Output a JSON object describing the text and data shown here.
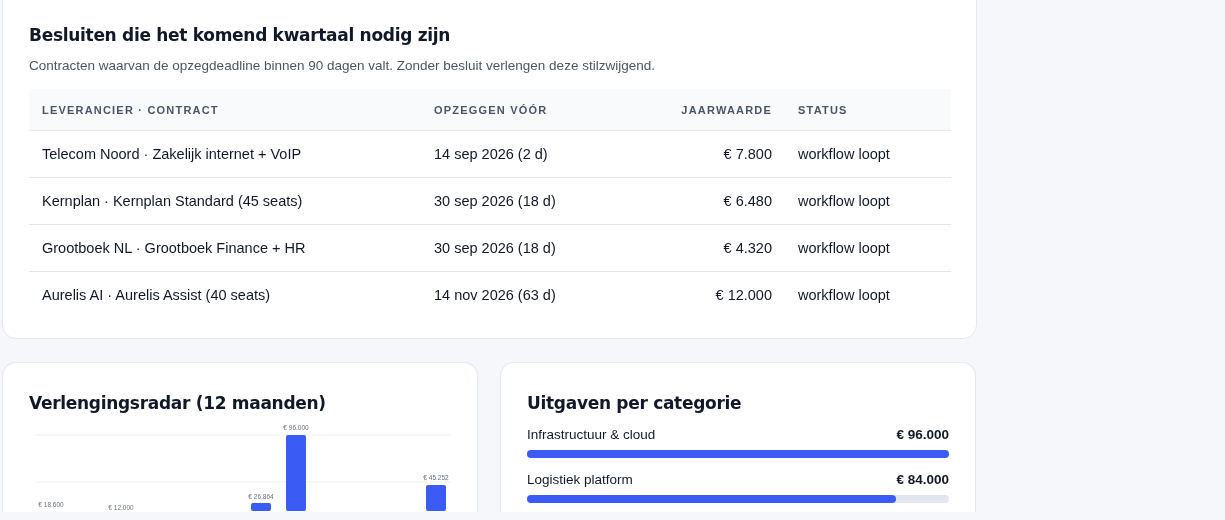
{
  "decisions": {
    "title": "Besluiten die het komend kwartaal nodig zijn",
    "subtitle": "Contracten waarvan de opzegdeadline binnen 90 dagen valt. Zonder besluit verlengen deze stilzwijgend.",
    "columns": [
      "LEVERANCIER · CONTRACT",
      "OPZEGGEN VÓÓR",
      "JAARWAARDE",
      "STATUS"
    ],
    "rows": [
      {
        "contract": "Telecom Noord · Zakelijk internet + VoIP",
        "deadline": "14 sep 2026 (2 d)",
        "value": "€ 7.800",
        "status": "workflow loopt"
      },
      {
        "contract": "Kernplan · Kernplan Standard (45 seats)",
        "deadline": "30 sep 2026 (18 d)",
        "value": "€ 6.480",
        "status": "workflow loopt"
      },
      {
        "contract": "Grootboek NL · Grootboek Finance + HR",
        "deadline": "30 sep 2026 (18 d)",
        "value": "€ 4.320",
        "status": "workflow loopt"
      },
      {
        "contract": "Aurelis AI · Aurelis Assist (40 seats)",
        "deadline": "14 nov 2026 (63 d)",
        "value": "€ 12.000",
        "status": "workflow loopt"
      }
    ]
  },
  "radar": {
    "title": "Verlengingsradar (12 maanden)",
    "bar_labels": [
      "€ 18.600",
      "€ 12.000",
      "€ 26.864",
      "€ 96.000",
      "€ 45.252"
    ]
  },
  "categories": {
    "title": "Uitgaven per categorie",
    "items": [
      {
        "name": "Infrastructuur & cloud",
        "amount": "€ 96.000",
        "level": 1
      },
      {
        "name": "Logistiek platform",
        "amount": "€ 84.000",
        "level": 0.875
      }
    ]
  }
}
